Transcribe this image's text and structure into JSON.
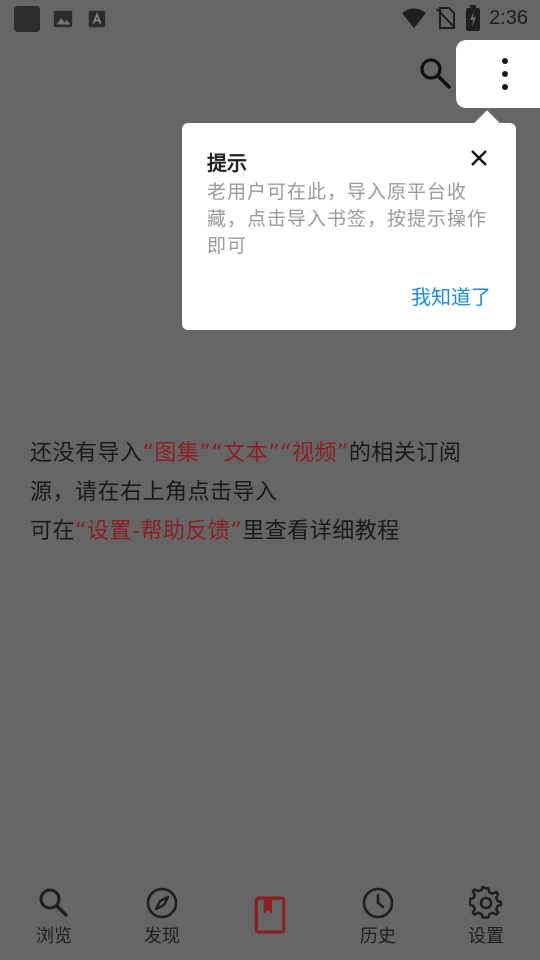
{
  "status_bar": {
    "time": "2:36",
    "left_icons": [
      "app-square-icon",
      "image-icon",
      "font-icon"
    ],
    "right_icons": [
      "wifi-icon",
      "no-sim-icon",
      "battery-charging-icon"
    ]
  },
  "toolbar": {
    "search_icon": "search-icon",
    "menu_icon": "more-vert-icon"
  },
  "tooltip": {
    "title": "提示",
    "body": "老用户可在此，导入原平台收藏，点击导入书签，按提示操作即可",
    "confirm": "我知道了"
  },
  "message": {
    "part1": "还没有导入",
    "hl_album": "“图集”",
    "hl_text": "“文本”",
    "hl_video": "“视频”",
    "part2": "的相关订阅源，请在右上角点击导入",
    "part3": "可在",
    "hl_settings": "“设置-帮助反馈”",
    "part4": "里查看详细教程",
    "highlight_color": "#8b1f25"
  },
  "bottom_nav": {
    "items": [
      {
        "label": "浏览",
        "icon": "search-icon"
      },
      {
        "label": "发现",
        "icon": "compass-icon"
      },
      {
        "label": "",
        "icon": "bookmark-book-icon",
        "active": true,
        "color": "#8b1f25"
      },
      {
        "label": "历史",
        "icon": "clock-icon"
      },
      {
        "label": "设置",
        "icon": "gear-icon"
      }
    ]
  }
}
